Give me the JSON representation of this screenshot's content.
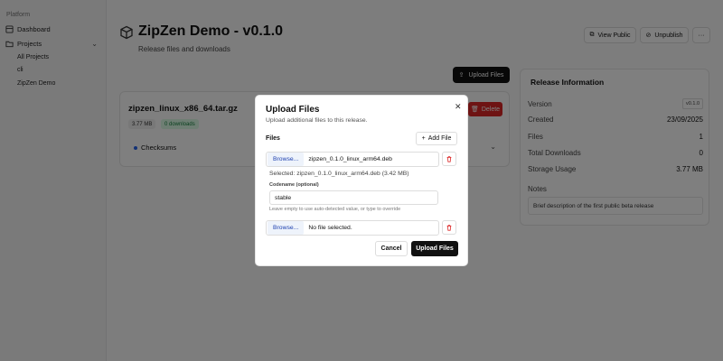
{
  "sidebar": {
    "section_label": "Platform",
    "dashboard_label": "Dashboard",
    "projects_label": "Projects",
    "sub_items": [
      "All Projects",
      "cli",
      "ZipZen Demo"
    ]
  },
  "header": {
    "title": "ZipZen Demo - v0.1.0",
    "subtitle": "Release files and downloads",
    "view_public_label": "View Public",
    "unpublish_label": "Unpublish",
    "more_label": "···"
  },
  "upload_files_label": "Upload Files",
  "file_card": {
    "name": "zipzen_linux_x86_64.tar.gz",
    "size": "3.77 MB",
    "downloads": "0 downloads",
    "checksums_label": "Checksums",
    "delete_label": "Delete"
  },
  "release_info": {
    "title": "Release Information",
    "version_label": "Version",
    "version_value": "v0.1.0",
    "created_label": "Created",
    "created_value": "23/09/2025",
    "files_label": "Files",
    "files_value": "1",
    "downloads_label": "Total Downloads",
    "downloads_value": "0",
    "storage_label": "Storage Usage",
    "storage_value": "3.77 MB",
    "notes_label": "Notes",
    "notes_value": "Brief description of the first public beta release"
  },
  "modal": {
    "title": "Upload Files",
    "description": "Upload additional files to this release.",
    "close_label": "✕",
    "files_label": "Files",
    "add_file_label": "Add File",
    "browse_label": "Browse...",
    "file1_name": "zipzen_0.1.0_linux_arm64.deb",
    "selected_text": "Selected: zipzen_0.1.0_linux_arm64.deb (3.42 MB)",
    "codename_label": "Codename (optional)",
    "codename_value": "stable",
    "help_text": "Leave empty to use auto-detected value, or type to override",
    "file2_name": "No file selected.",
    "cancel_label": "Cancel",
    "upload_label": "Upload Files"
  },
  "colors": {
    "danger": "#dc2626",
    "primary_dark": "#111111",
    "success_badge_bg": "#dcfce7",
    "success_badge_text": "#15803d",
    "checksum_dot": "#2563eb"
  }
}
